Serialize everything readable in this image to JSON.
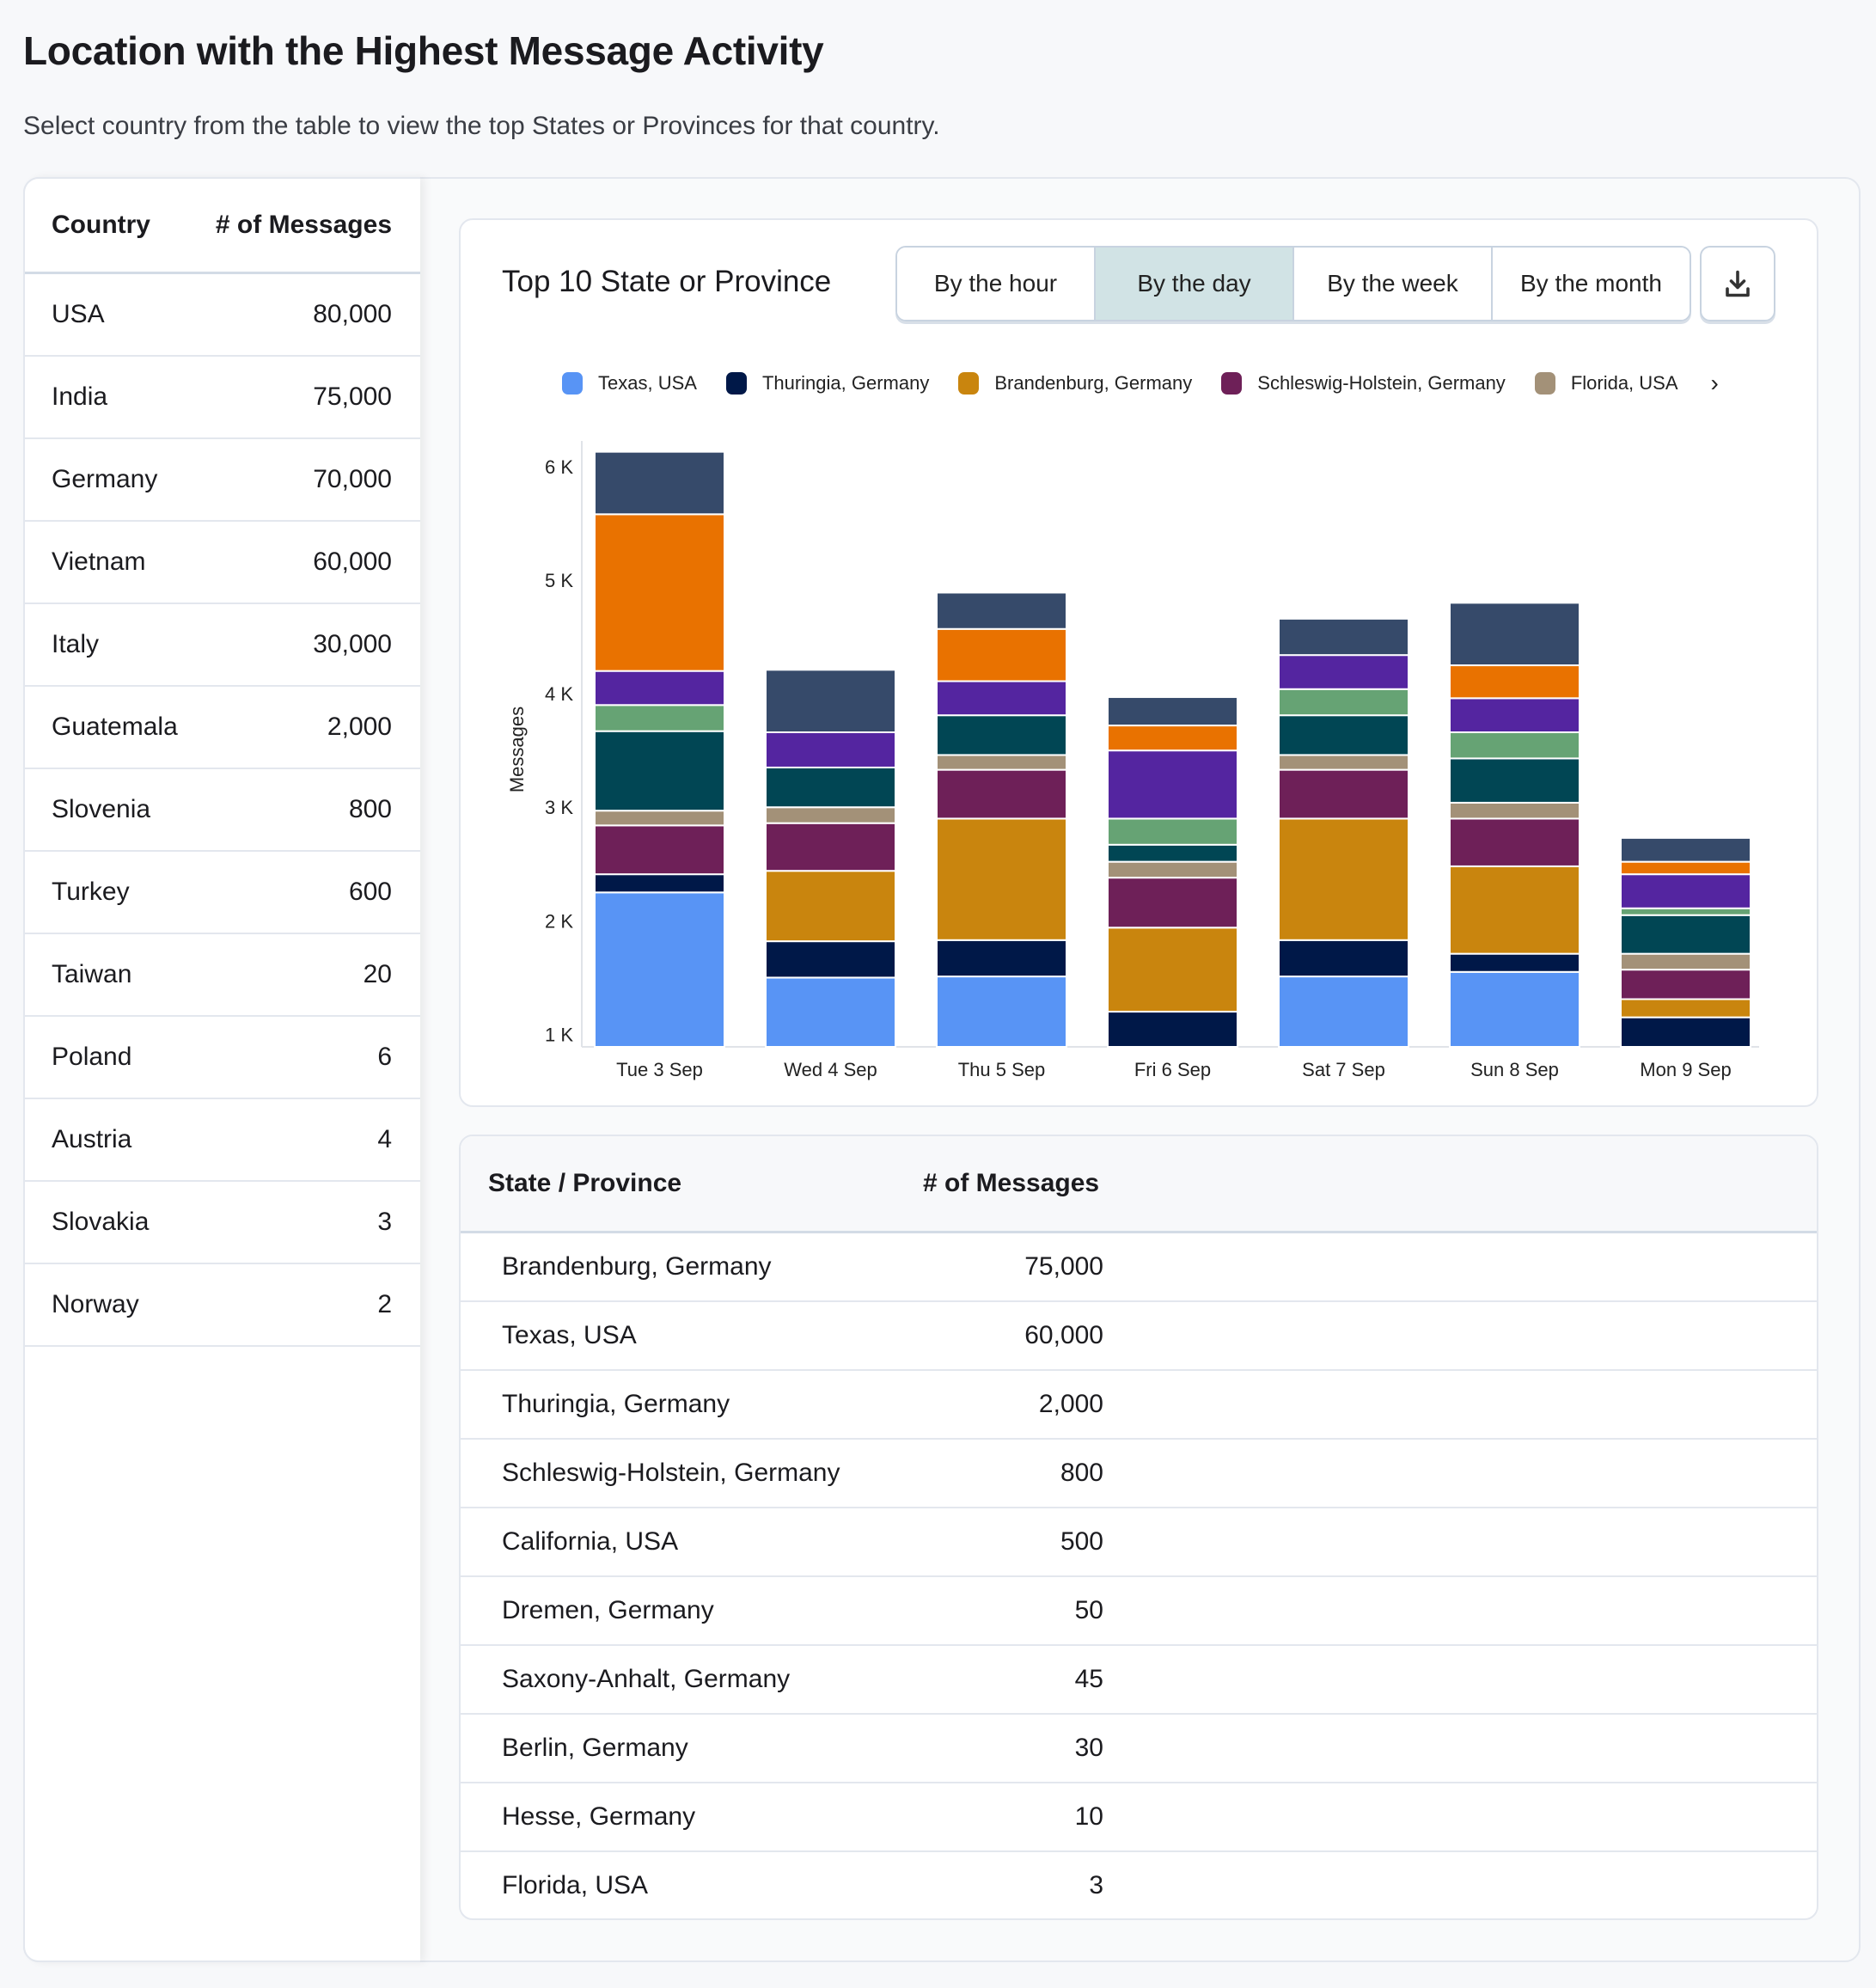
{
  "page": {
    "title": "Location with the Highest Message Activity",
    "subtitle": "Select country from the table to view the top States or Provinces for that country."
  },
  "country_table": {
    "headers": [
      "Country",
      "# of Messages"
    ],
    "rows": [
      [
        "USA",
        "80,000"
      ],
      [
        "India",
        "75,000"
      ],
      [
        "Germany",
        "70,000"
      ],
      [
        "Vietnam",
        "60,000"
      ],
      [
        "Italy",
        "30,000"
      ],
      [
        "Guatemala",
        "2,000"
      ],
      [
        "Slovenia",
        "800"
      ],
      [
        "Turkey",
        "600"
      ],
      [
        "Taiwan",
        "20"
      ],
      [
        "Poland",
        "6"
      ],
      [
        "Austria",
        "4"
      ],
      [
        "Slovakia",
        "3"
      ],
      [
        "Norway",
        "2"
      ]
    ]
  },
  "chart_card": {
    "title": "Top 10 State or Province",
    "buttons": [
      "By the hour",
      "By the day",
      "By the week",
      "By the month"
    ],
    "active_button": 1,
    "download_icon": "download-icon",
    "legend_next_icon": "chevron-right-icon"
  },
  "chart_data": {
    "type": "bar",
    "stacked": true,
    "title": "Top 10 State or Province",
    "xlabel": "",
    "ylabel": "Messages",
    "ylim": [
      890,
      6150
    ],
    "yticks": [
      1000,
      2000,
      3000,
      4000,
      5000,
      6000
    ],
    "ytick_labels": [
      "1 K",
      "2 K",
      "3 K",
      "4 K",
      "5 K",
      "6 K"
    ],
    "categories": [
      "Tue 3 Sep",
      "Wed 4 Sep",
      "Thu 5 Sep",
      "Fri 6 Sep",
      "Sat 7 Sep",
      "Sun 8 Sep",
      "Mon 9 Sep"
    ],
    "legend_visible_count": 5,
    "legend_placement": "top",
    "series": [
      {
        "name": "Texas, USA",
        "color": "#5894f5",
        "values": [
          1360,
          610,
          620,
          0,
          620,
          660,
          0
        ]
      },
      {
        "name": "Thuringia, Germany",
        "color": "#001848",
        "values": [
          160,
          320,
          320,
          310,
          320,
          160,
          260
        ]
      },
      {
        "name": "Brandenburg, Germany",
        "color": "#c9850e",
        "values": [
          0,
          620,
          1070,
          740,
          1070,
          770,
          160
        ]
      },
      {
        "name": "Schleswig-Holstein, Germany",
        "color": "#6e2058",
        "values": [
          430,
          420,
          430,
          440,
          430,
          420,
          260
        ]
      },
      {
        "name": "Florida, USA",
        "color": "#a39178",
        "values": [
          130,
          140,
          130,
          140,
          130,
          140,
          140
        ]
      },
      {
        "name": "",
        "color": "#014654",
        "values": [
          700,
          350,
          350,
          150,
          350,
          390,
          340
        ]
      },
      {
        "name": "",
        "color": "#66a374",
        "values": [
          230,
          0,
          0,
          230,
          230,
          230,
          60
        ]
      },
      {
        "name": "",
        "color": "#5425a0",
        "values": [
          300,
          310,
          300,
          600,
          300,
          300,
          300
        ]
      },
      {
        "name": "",
        "color": "#e97200",
        "values": [
          1380,
          0,
          460,
          220,
          0,
          290,
          110
        ]
      },
      {
        "name": "",
        "color": "#364a6a",
        "values": [
          550,
          550,
          320,
          250,
          320,
          550,
          210
        ]
      }
    ]
  },
  "state_table": {
    "headers": [
      "State / Province",
      "# of Messages"
    ],
    "rows": [
      [
        "Brandenburg, Germany",
        "75,000"
      ],
      [
        "Texas, USA",
        "60,000"
      ],
      [
        "Thuringia, Germany",
        "2,000"
      ],
      [
        "Schleswig-Holstein, Germany",
        "800"
      ],
      [
        "California, USA",
        "500"
      ],
      [
        "Dremen, Germany",
        "50"
      ],
      [
        "Saxony-Anhalt, Germany",
        "45"
      ],
      [
        "Berlin, Germany",
        "30"
      ],
      [
        "Hesse, Germany",
        "10"
      ],
      [
        "Florida, USA",
        "3"
      ]
    ]
  }
}
